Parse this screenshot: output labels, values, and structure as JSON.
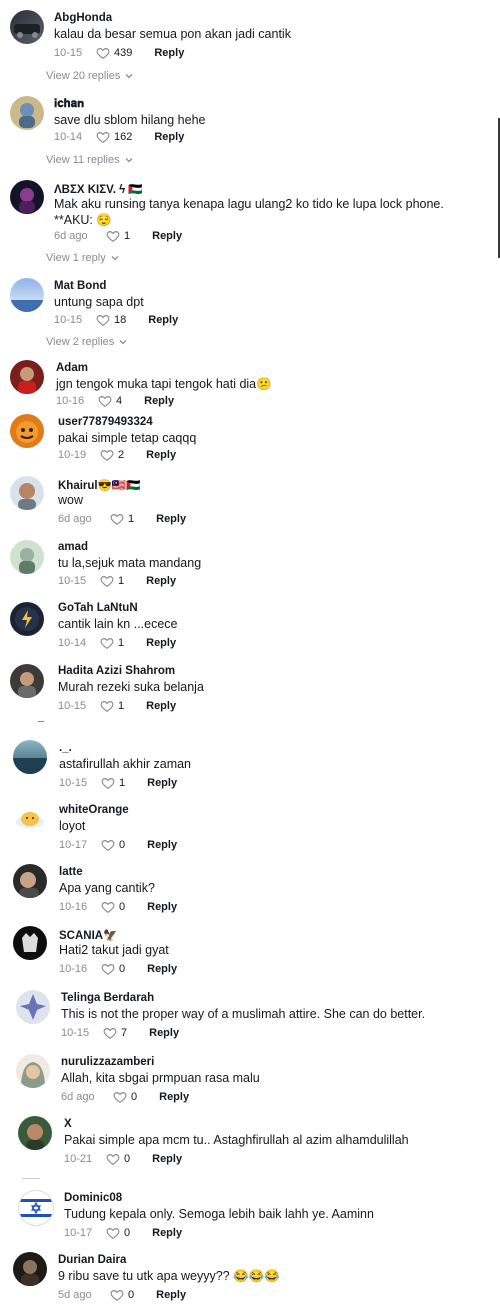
{
  "comments": [
    {
      "username": "AbgHonda",
      "text": "kalau da besar semua pon akan jadi cantik",
      "date": "10-15",
      "likes": "439",
      "reply": "Reply",
      "view_replies": "View 20 replies"
    },
    {
      "username": "𝐢𝐜𝐡𝐚𝐧",
      "text": "save dlu sblom hilang hehe",
      "date": "10-14",
      "likes": "162",
      "reply": "Reply",
      "view_replies": "View 11 replies"
    },
    {
      "username": "ΛΒΣΧ ΚΙΣV. ϟ 🇵🇸",
      "text": "Mak aku runsing tanya kenapa lagu ulang2 ko tido ke lupa lock phone. **AKU: 😌",
      "date": "6d ago",
      "likes": "1",
      "reply": "Reply",
      "view_replies": "View 1 reply"
    },
    {
      "username": "Mat Bond",
      "text": "untung sapa dpt",
      "date": "10-15",
      "likes": "18",
      "reply": "Reply",
      "view_replies": "View 2 replies"
    },
    {
      "username": "Adam",
      "text": "jgn tengok muka tapi tengok hati dia😕",
      "date": "10-16",
      "likes": "4",
      "reply": "Reply"
    },
    {
      "username": "user77879493324",
      "text": "pakai simple tetap caqqq",
      "date": "10-19",
      "likes": "2",
      "reply": "Reply"
    },
    {
      "username": "Khairul😎🇲🇾🇵🇸",
      "text": "wow",
      "date": "6d ago",
      "likes": "1",
      "reply": "Reply"
    },
    {
      "username": "amad",
      "text": "tu la,sejuk mata mandang",
      "date": "10-15",
      "likes": "1",
      "reply": "Reply"
    },
    {
      "username": "GoTah LaNtuN",
      "text": "cantik lain kn ...ecece",
      "date": "10-14",
      "likes": "1",
      "reply": "Reply"
    },
    {
      "username": "Hadita Azizi Shahrom",
      "text": "Murah rezeki suka belanja",
      "date": "10-15",
      "likes": "1",
      "reply": "Reply"
    },
    {
      "username": "._.",
      "text": "astafirullah akhir zaman",
      "date": "10-15",
      "likes": "1",
      "reply": "Reply"
    },
    {
      "username": "whiteOrange",
      "text": "loyot",
      "date": "10-17",
      "likes": "0",
      "reply": "Reply"
    },
    {
      "username": "latte",
      "text": "Apa yang cantik?",
      "date": "10-16",
      "likes": "0",
      "reply": "Reply"
    },
    {
      "username": "SCANIA🦅",
      "text": "Hati2 takut jadi gyat",
      "date": "10-16",
      "likes": "0",
      "reply": "Reply"
    },
    {
      "username": "Telinga Berdarah",
      "text": "This is not the proper way of a muslimah attire. She can do better.",
      "date": "10-15",
      "likes": "7",
      "reply": "Reply"
    },
    {
      "username": "nurulizzazamberi",
      "text": "Allah, kita sbgai prmpuan rasa malu",
      "date": "6d ago",
      "likes": "0",
      "reply": "Reply"
    },
    {
      "username": "X",
      "text": "Pakai simple apa mcm tu.. Astaghfirullah al azim alhamdulillah",
      "date": "10-21",
      "likes": "0",
      "reply": "Reply"
    },
    {
      "username": "Dominic08",
      "text": "Tudung kepala only. Semoga lebih baik lahh ye. Aaminn",
      "date": "10-17",
      "likes": "0",
      "reply": "Reply"
    },
    {
      "username": "Durian Daira",
      "text": "9 ribu save tu utk apa weyyy?? 😂😂😂",
      "date": "5d ago",
      "likes": "0",
      "reply": "Reply"
    }
  ],
  "colors": {
    "text": "#161823",
    "muted": "#8a8b91",
    "background": "#ffffff"
  },
  "icons": {
    "like": "heart-outline-icon",
    "expand": "chevron-down-icon"
  }
}
